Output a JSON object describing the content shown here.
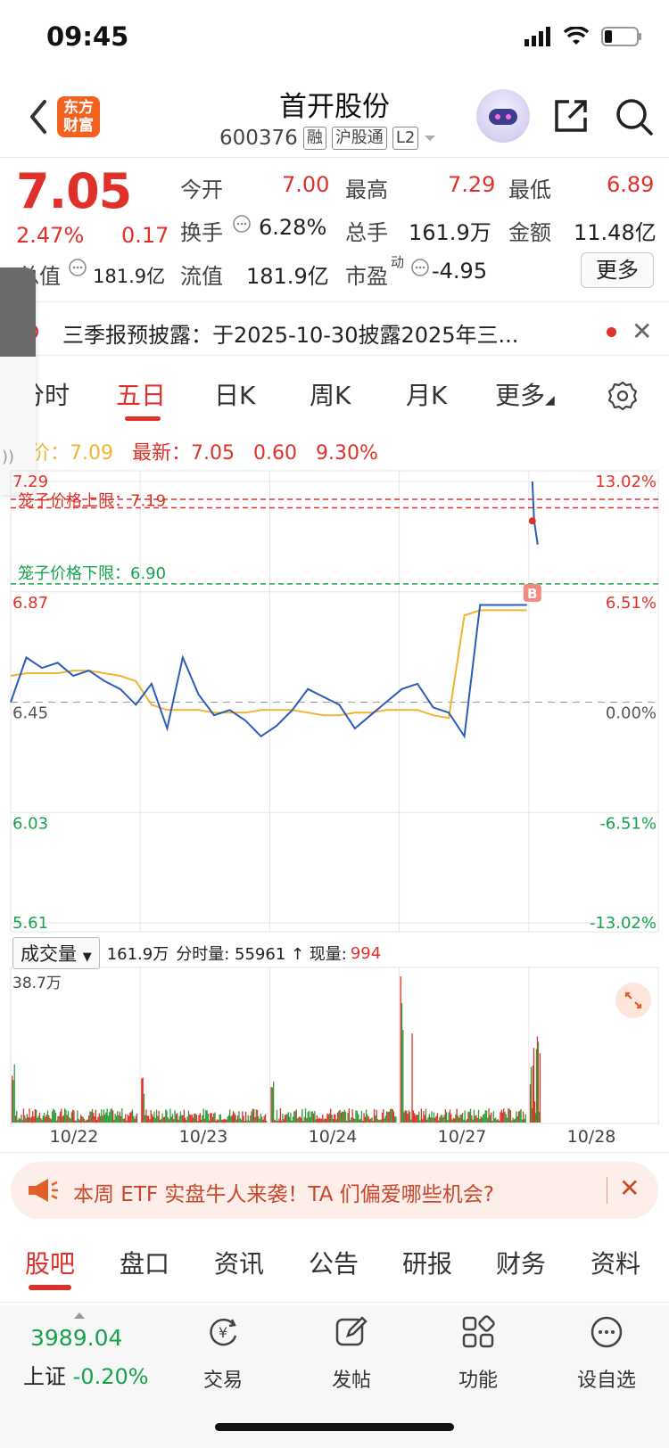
{
  "status": {
    "time": "09:45"
  },
  "header": {
    "stock_name": "首开股份",
    "stock_code": "600376",
    "tags": [
      "融",
      "沪股通",
      "L2"
    ],
    "logo_text_1": "东方",
    "logo_text_2": "财富"
  },
  "quote": {
    "price": "7.05",
    "change_pct": "2.47%",
    "change_abs": "0.17",
    "open_label": "今开",
    "open": "7.00",
    "high_label": "最高",
    "high": "7.29",
    "low_label": "最低",
    "low": "6.89",
    "turnover_label": "换手",
    "turnover": "6.28%",
    "volume_label": "总手",
    "volume": "161.9万",
    "amount_label": "金额",
    "amount": "11.48亿",
    "mktcap_label": "总值",
    "mktcap": "181.9亿",
    "float_label": "流值",
    "float_cap": "181.9亿",
    "pe_label": "市盈",
    "pe_sup": "动",
    "pe": "-4.95",
    "more_label": "更多"
  },
  "notice": {
    "text": "三季报预披露：于2025-10-30披露2025年三..."
  },
  "tabs": [
    "分时",
    "五日",
    "日K",
    "周K",
    "月K",
    "更多"
  ],
  "active_tab": "五日",
  "summary": {
    "avg_label": "均价：",
    "avg": "7.09",
    "latest_label": "最新：",
    "latest": "7.05",
    "change": "0.60",
    "change_pct": "9.30%"
  },
  "chart_data": {
    "type": "line",
    "title": "",
    "x_dates": [
      "10/22",
      "10/23",
      "10/24",
      "10/27",
      "10/28"
    ],
    "y_left_ticks": [
      "7.29",
      "6.87",
      "6.45",
      "6.03",
      "5.61"
    ],
    "y_right_ticks": [
      "13.02%",
      "6.51%",
      "0.00%",
      "-6.51%",
      "-13.02%"
    ],
    "ylim": [
      5.61,
      7.29
    ],
    "reference_price": 6.45,
    "upper_band_label": "笼子价格上限：7.19",
    "upper_band": 7.19,
    "lower_band_label": "笼子价格下限：6.90",
    "lower_band": 6.9,
    "marker": "B",
    "series": [
      {
        "name": "price",
        "color": "#2a5cb8",
        "values": [
          6.45,
          6.62,
          6.58,
          6.6,
          6.55,
          6.57,
          6.53,
          6.5,
          6.44,
          6.52,
          6.35,
          6.62,
          6.48,
          6.4,
          6.42,
          6.38,
          6.32,
          6.36,
          6.42,
          6.5,
          6.47,
          6.44,
          6.35,
          6.4,
          6.45,
          6.5,
          6.52,
          6.43,
          6.41,
          6.32,
          6.82,
          6.82,
          6.82,
          6.82,
          7.29,
          7.14,
          7.05
        ]
      },
      {
        "name": "average",
        "color": "#f0b432",
        "values": [
          6.55,
          6.56,
          6.56,
          6.56,
          6.57,
          6.57,
          6.56,
          6.55,
          6.53,
          6.44,
          6.42,
          6.42,
          6.42,
          6.41,
          6.41,
          6.41,
          6.42,
          6.42,
          6.42,
          6.41,
          6.4,
          6.4,
          6.41,
          6.41,
          6.42,
          6.42,
          6.42,
          6.4,
          6.39,
          6.78,
          6.8,
          6.8,
          6.8,
          6.8,
          6.8,
          6.8,
          6.8
        ]
      }
    ],
    "volume": {
      "selector_label": "成交量",
      "total": "161.9万",
      "detail": "分时量: 55961 ↑ 现量:",
      "current": "994",
      "max_label": "38.7万"
    }
  },
  "promo": {
    "text": "本周 ETF 实盘牛人来袭！TA 们偏爱哪些机会?"
  },
  "bottom_tabs": [
    "股吧",
    "盘口",
    "资讯",
    "公告",
    "研报",
    "财务",
    "资料"
  ],
  "bottom_nav": {
    "index_value": "3989.04",
    "index_name": "上证",
    "index_change": "-0.20%",
    "items": [
      "交易",
      "发帖",
      "功能",
      "设自选"
    ]
  },
  "side_tab_text": "))"
}
